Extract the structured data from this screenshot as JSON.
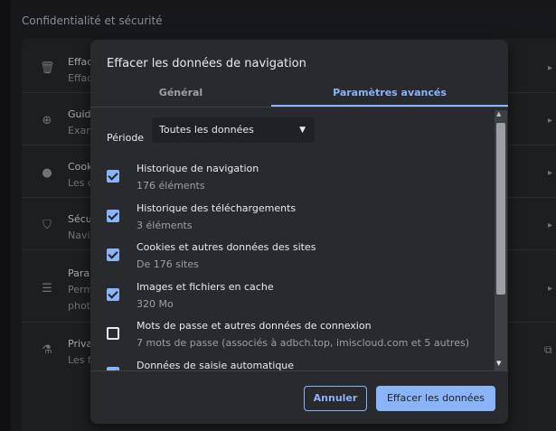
{
  "background": {
    "section_title": "Confidentialité et sécurité",
    "rows": [
      {
        "icon": "trash-icon",
        "line1": "Effacer",
        "line2": "Effacer"
      },
      {
        "icon": "compass-icon",
        "line1": "Guide",
        "line2": "Exam"
      },
      {
        "icon": "cookie-icon",
        "line1": "Cookies",
        "line2": "Les c"
      },
      {
        "icon": "shield-icon",
        "line1": "Sécurité",
        "line2": "Navig"
      },
      {
        "icon": "sliders-icon",
        "line1": "Param",
        "line2": "Perm",
        "line3": "phot"
      },
      {
        "icon": "flask-icon",
        "line1": "Priva",
        "line2": "Les f"
      }
    ]
  },
  "dialog": {
    "title": "Effacer les données de navigation",
    "tabs": [
      {
        "label": "Général",
        "active": false
      },
      {
        "label": "Paramètres avancés",
        "active": true
      }
    ],
    "period": {
      "label": "Période",
      "value": "Toutes les données"
    },
    "items": [
      {
        "title": "Historique de navigation",
        "subtitle": "176 éléments",
        "checked": true
      },
      {
        "title": "Historique des téléchargements",
        "subtitle": "3 éléments",
        "checked": true
      },
      {
        "title": "Cookies et autres données des sites",
        "subtitle": "De 176 sites",
        "checked": true
      },
      {
        "title": "Images et fichiers en cache",
        "subtitle": "320 Mo",
        "checked": true
      },
      {
        "title": "Mots de passe et autres données de connexion",
        "subtitle": "7 mots de passe (associés à adbch.top, imiscloud.com et 5 autres)",
        "checked": false
      },
      {
        "title": "Données de saisie automatique",
        "subtitle": "",
        "checked": true
      }
    ],
    "buttons": {
      "cancel": "Annuler",
      "clear": "Effacer les données"
    }
  },
  "colors": {
    "accent": "#8ab4f8",
    "surface": "#292a2d",
    "background": "#202124"
  }
}
